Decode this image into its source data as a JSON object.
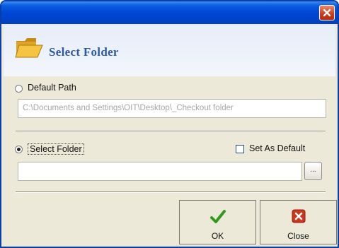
{
  "window": {
    "close_icon": "close-icon"
  },
  "header": {
    "title": "Select Folder",
    "icon": "folder-icon"
  },
  "default_path": {
    "label": "Default Path",
    "selected": false,
    "value": "C:\\Documents and Settings\\OIT\\Desktop\\_Checkout folder"
  },
  "select_folder": {
    "label": "Select Folder",
    "selected": true,
    "value": "",
    "browse_label": "..."
  },
  "set_as_default": {
    "label": "Set As Default",
    "checked": false
  },
  "buttons": {
    "ok_label": "OK",
    "close_label": "Close"
  },
  "colors": {
    "titlebar": "#0046d5",
    "header_text": "#2c5aa8",
    "ok_check": "#2f9a1e",
    "close_x": "#d0341a"
  }
}
